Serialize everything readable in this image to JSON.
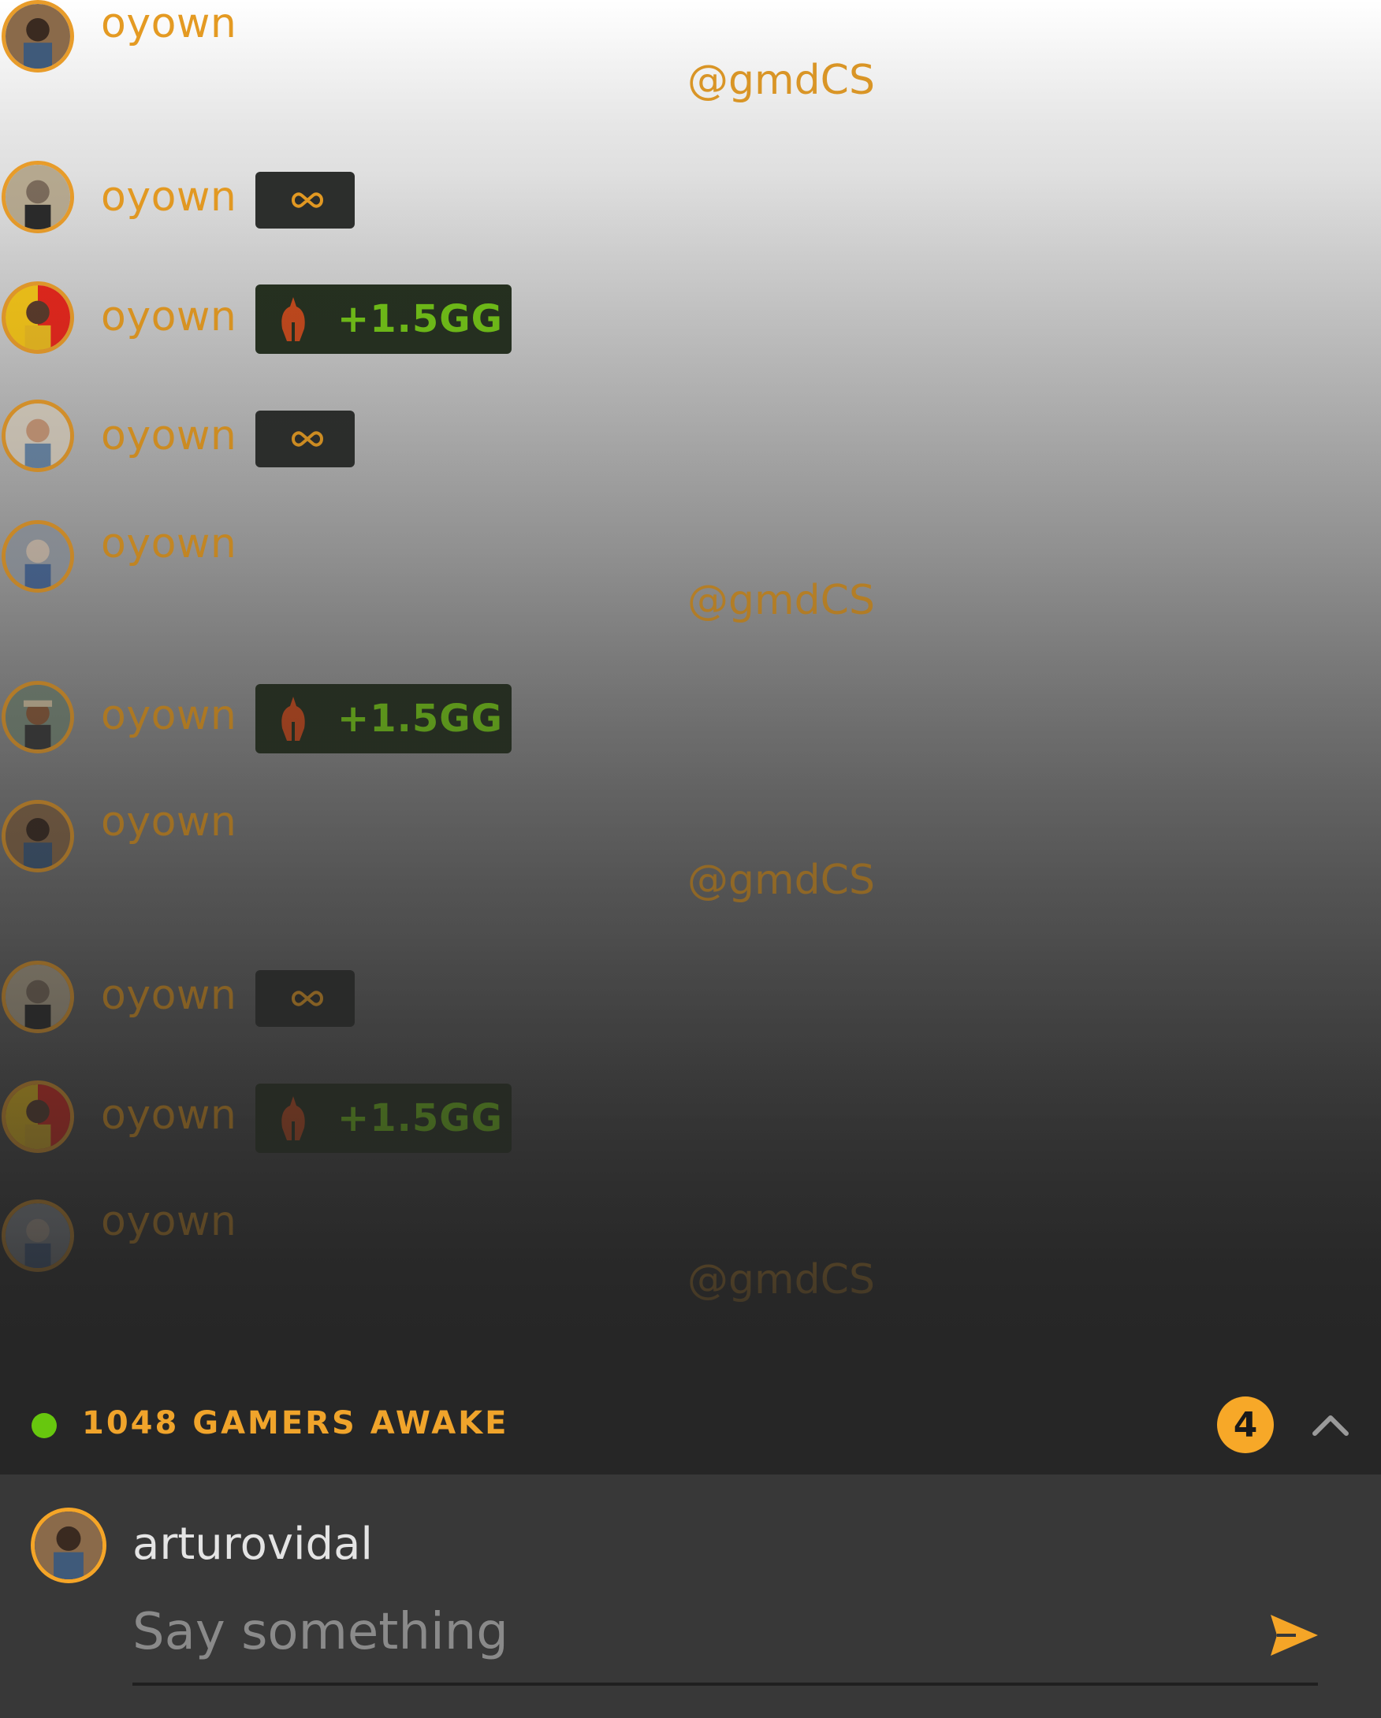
{
  "feed": {
    "items": [
      {
        "username": "oyown",
        "badge": "none",
        "mention": "@gmdCS"
      },
      {
        "username": "oyown",
        "badge": "infinity"
      },
      {
        "username": "oyown",
        "badge": "gg",
        "badge_text": "+1.5GG"
      },
      {
        "username": "oyown",
        "badge": "infinity"
      },
      {
        "username": "oyown",
        "badge": "none",
        "mention": "@gmdCS"
      },
      {
        "username": "oyown",
        "badge": "gg",
        "badge_text": "+1.5GG"
      },
      {
        "username": "oyown",
        "badge": "none",
        "mention": "@gmdCS"
      },
      {
        "username": "oyown",
        "badge": "infinity"
      },
      {
        "username": "oyown",
        "badge": "gg",
        "badge_text": "+1.5GG"
      },
      {
        "username": "oyown",
        "badge": "none",
        "mention": "@gmdCS"
      }
    ]
  },
  "status": {
    "online_text": "1048 GAMERS AWAKE",
    "notification_count": "4",
    "online_color": "#67c70e",
    "accent_color": "#f7a828"
  },
  "composer": {
    "username": "arturovidal",
    "placeholder": "Say something",
    "send_icon": "send-icon"
  }
}
